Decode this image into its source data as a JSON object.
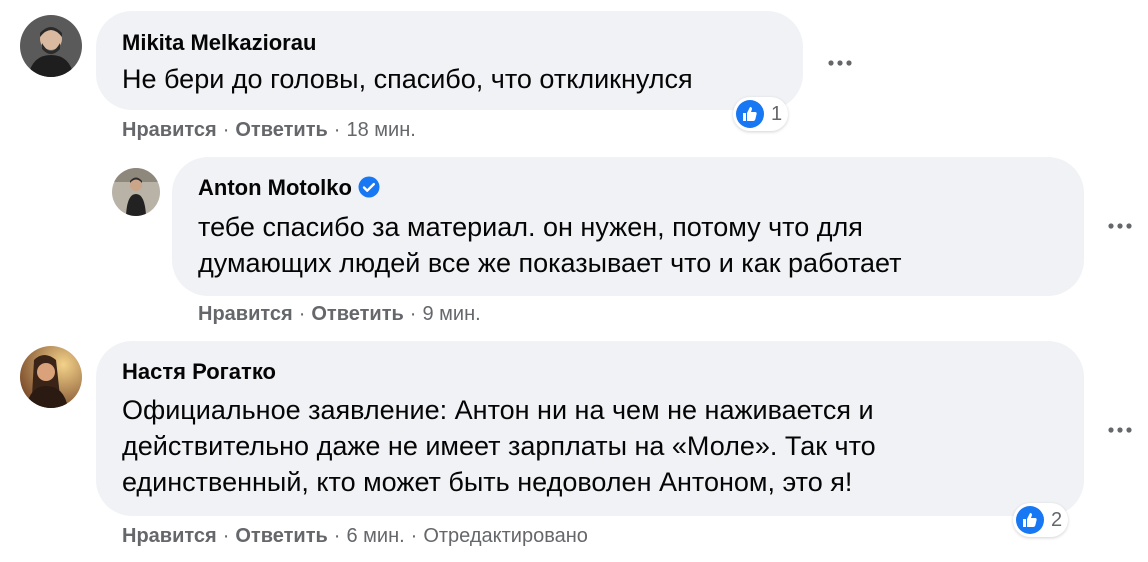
{
  "comments": [
    {
      "author": "Mikita Melkaziorau",
      "text_lines": [
        "Не бери до головы, спасибо, что откликнулся"
      ],
      "like_label": "Нравится",
      "reply_label": "Ответить",
      "time": "18 мин.",
      "reactions": {
        "icon": "like-icon",
        "count": "1"
      },
      "avatar_icon": "person-avatar"
    },
    {
      "author": "Anton Motolko",
      "verified": true,
      "text_lines": [
        "тебе спасибо за материал. он нужен, потому что для",
        "думающих людей все же показывает что и как работает"
      ],
      "like_label": "Нравится",
      "reply_label": "Ответить",
      "time": "9 мин.",
      "avatar_icon": "person-avatar"
    },
    {
      "author": "Настя Рогатко",
      "text_lines": [
        "Официальное заявление: Антон ни на чем не наживается и",
        "действительно даже не имеет зарплаты на «Моле». Так что",
        "единственный, кто может быть недоволен Антоном, это я!"
      ],
      "like_label": "Нравится",
      "reply_label": "Ответить",
      "time": "6 мин.",
      "edited_label": "Отредактировано",
      "reactions": {
        "icon": "like-icon",
        "count": "2"
      },
      "avatar_icon": "person-avatar"
    }
  ],
  "colors": {
    "bubble": "#f0f2f5",
    "meta_text": "#65676b",
    "like_blue": "#1877f2",
    "text": "#050505"
  }
}
